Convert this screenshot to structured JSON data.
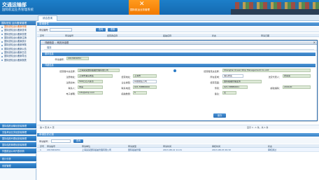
{
  "header": {
    "title": "交通运输部",
    "subtitle": "国际航运业务管理系统",
    "active_module": "国际航运业务管理"
  },
  "tabstrip": {
    "tab": "综合查询"
  },
  "sidebar": {
    "title": "国际班轮  运价备案管理",
    "items": [
      "国际班轮运价备案申报",
      "国际班轮运价备案查询",
      "国际班轮运价备案变更",
      "国际班轮运价备案注销",
      "国际班轮运价备案统计",
      "国际班轮运价备案审核",
      "国际班轮运价备案公告",
      "国际班轮运价备案日志",
      "国际班轮运价备案导出",
      "国际班轮运价备案报表"
    ],
    "groups": [
      "国际船舶运输经营者管理",
      "无船承运业务经营者管理",
      "国际船舶代理经营者管理",
      "国际船舶管理经营者管理",
      "外国航运公司代表机构",
      "统计分析",
      "系统管理"
    ]
  },
  "main": {
    "panel_title": "查询条件",
    "filter": {
      "label": "申请编号",
      "query": "查询",
      "reset": "重置"
    },
    "list_headers": [
      "序号",
      "申请编号",
      "经营者名称",
      "船舶名称",
      "状态",
      "申请日期"
    ]
  },
  "modal": {
    "title": "详细信息 -- 网页对话框",
    "close": "×",
    "save": "保存",
    "sec1": "基本信息",
    "apply_no_label": "申请编号：",
    "apply_no": "2013001051",
    "sec2": "详细信息",
    "fields": {
      "company_cn_l": "经营者中文名称：",
      "company_cn": "上海某某国际船舶管理有限公司",
      "company_en_l": "经营者英文名称：",
      "company_en": "Shanghai Ocean Ship Management Co.,Ltd",
      "reg_addr_l": "注册地址：",
      "reg_addr": "上海市浦东新区",
      "office_addr_l": "经营地址：",
      "office_addr": "上海市",
      "area_l": "所在区域：",
      "area": "浦东新区",
      "legal_l": "法定代表人：",
      "legal": "张某某",
      "capital_l": "注册资本：",
      "capital": "500万元人民币",
      "type_l": "企业类型：",
      "type": "有限责任公司",
      "scope_l": "经营范围：",
      "scope": "国际船舶管理业务",
      "contact_l": "联系人：",
      "contact": "李某",
      "phone_l": "联系电话：",
      "phone": "021-58880000",
      "fax_l": "传真：",
      "fax": "021-58880001",
      "post_l": "邮政编码：",
      "post": "200120",
      "email_l": "电子邮箱：",
      "email": "info@ship.com",
      "ships_l": "船舶数量：",
      "ships": "5",
      "remark_l": "备注：",
      "remark": "无"
    }
  },
  "pager": {
    "text": "第 1 页 共 1 页",
    "count": "显示 1 - 1 条，共 1 条"
  },
  "bottom": {
    "panel_title": "申请历史记录",
    "filter_label": "申请编号：",
    "query": "查询",
    "headers": [
      "序号",
      "申请编号",
      "申请单位",
      "申请类型",
      "申请时间",
      "审核时间",
      "状态"
    ],
    "row": [
      "1",
      "2013001051",
      "上海某某国际船舶管理有限公司",
      "国际船舶管理",
      "2013-08-12 11:21",
      "2013-08-15 09:32",
      "审核通过"
    ]
  },
  "colors": {
    "header": "#1469b0",
    "accent": "#f27a00",
    "field_bg": "#dde9d7"
  }
}
